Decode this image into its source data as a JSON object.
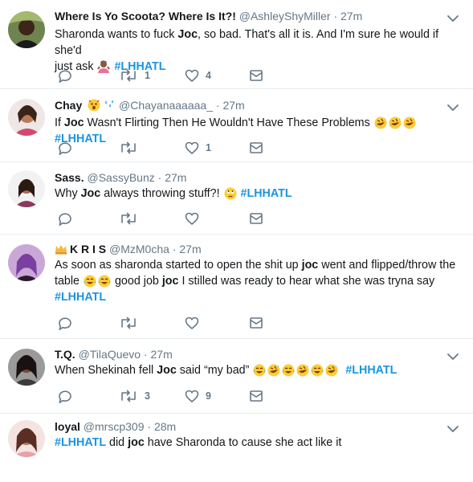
{
  "tweets": [
    {
      "name": "Where Is Yo Scoota? Where Is It?!",
      "handle": "@AshleyShyMiller",
      "time": "27m",
      "replies": "",
      "retweets": "1",
      "likes": "4",
      "text_parts": [
        "Sharonda wants to fuck ",
        "Joc",
        ", so bad. That's all it is. And I'm sure he would if she'd",
        "just ask",
        "#LHHATL"
      ]
    },
    {
      "name": "Chay",
      "handle": "@Chayanaaaaaa_",
      "time": "27m",
      "replies": "",
      "retweets": "",
      "likes": "1",
      "text_parts": [
        "If ",
        "Joc",
        " Wasn't Flirting Then He Wouldn't Have These Problems",
        "#LHHATL"
      ]
    },
    {
      "name": "Sass.",
      "handle": "@SassyBunz",
      "time": "27m",
      "replies": "",
      "retweets": "",
      "likes": "",
      "text_parts": [
        "Why ",
        "Joc",
        " always throwing stuff?!",
        "#LHHATL"
      ]
    },
    {
      "name": "K R I S",
      "handle": "@MzM0cha",
      "time": "27m",
      "replies": "",
      "retweets": "",
      "likes": "",
      "text_parts": [
        "As soon as sharonda started to open the shit up ",
        "joc",
        " went and flipped/throw the",
        "table",
        "good job ",
        "joc",
        " I stilled was ready to hear what she was tryna say",
        "#LHHATL"
      ]
    },
    {
      "name": "T.Q.",
      "handle": "@TilaQuevo",
      "time": "27m",
      "replies": "",
      "retweets": "3",
      "likes": "9",
      "text_parts": [
        "When Shekinah fell ",
        "Joc",
        " said “my bad”",
        "#LHHATL"
      ]
    },
    {
      "name": "loyal",
      "handle": "@mrscp309",
      "time": "28m",
      "replies": "",
      "retweets": "",
      "likes": "",
      "text_parts": [
        "#LHHATL",
        " did ",
        "joc",
        " have Sharonda to cause she act like it"
      ]
    }
  ],
  "colors": {
    "hashtag": "#1b95e0",
    "meta": "#657786",
    "divider": "#e6ecf0"
  },
  "icons": [
    "reply-icon",
    "retweet-icon",
    "like-icon",
    "direct-message-icon",
    "chevron-down-icon"
  ]
}
